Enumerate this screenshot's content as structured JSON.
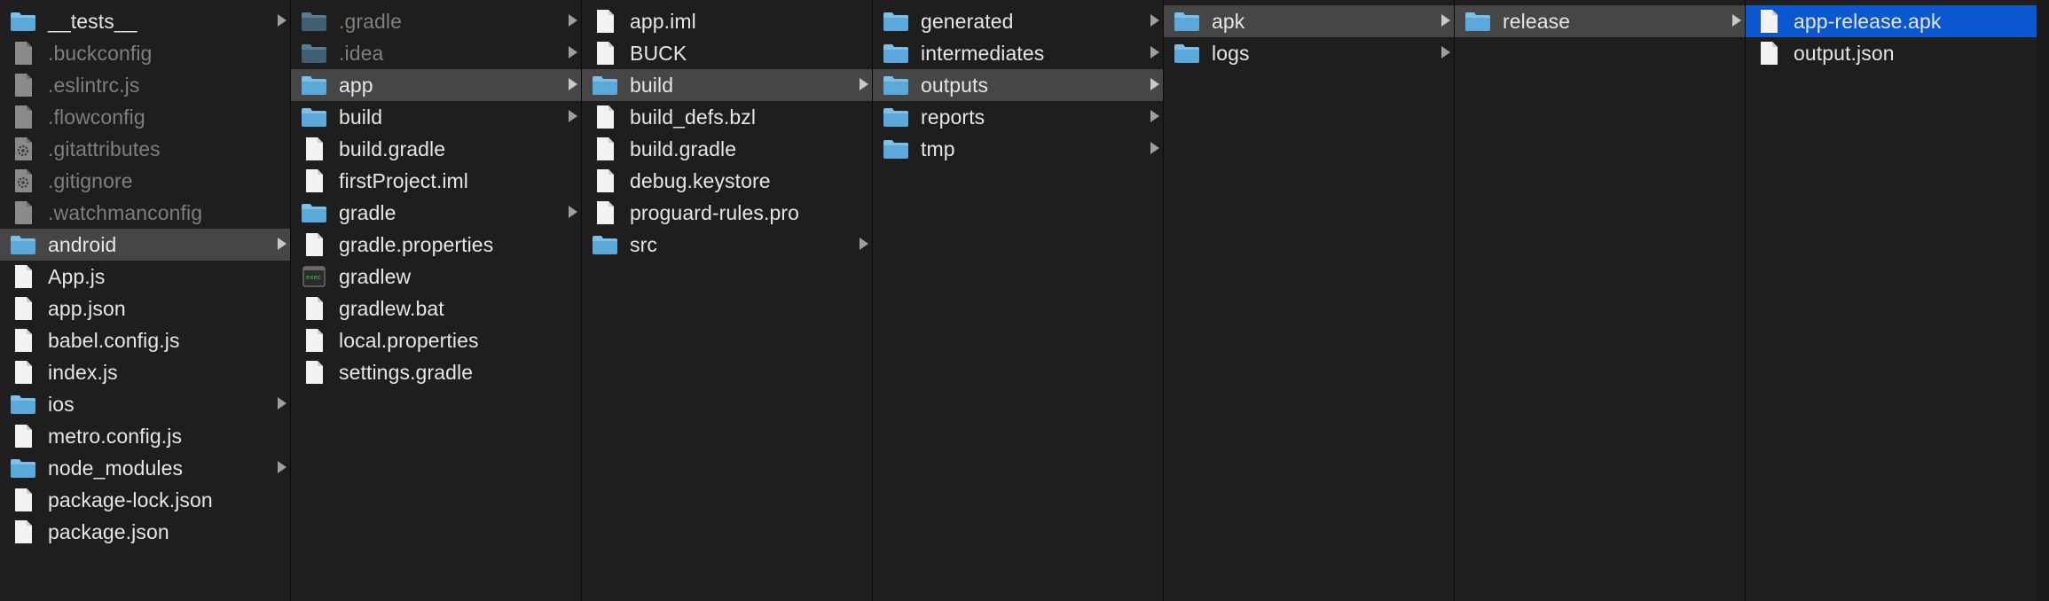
{
  "columns": [
    {
      "items": [
        {
          "name": "__tests__",
          "type": "folder",
          "arrow": true
        },
        {
          "name": ".buckconfig",
          "type": "file",
          "dim": true
        },
        {
          "name": ".eslintrc.js",
          "type": "file",
          "dim": true
        },
        {
          "name": ".flowconfig",
          "type": "file",
          "dim": true
        },
        {
          "name": ".gitattributes",
          "type": "config",
          "dim": true
        },
        {
          "name": ".gitignore",
          "type": "config",
          "dim": true
        },
        {
          "name": ".watchmanconfig",
          "type": "file",
          "dim": true
        },
        {
          "name": "android",
          "type": "folder",
          "arrow": true,
          "selected": true
        },
        {
          "name": "App.js",
          "type": "file"
        },
        {
          "name": "app.json",
          "type": "file"
        },
        {
          "name": "babel.config.js",
          "type": "file"
        },
        {
          "name": "index.js",
          "type": "file"
        },
        {
          "name": "ios",
          "type": "folder",
          "arrow": true
        },
        {
          "name": "metro.config.js",
          "type": "file"
        },
        {
          "name": "node_modules",
          "type": "folder",
          "arrow": true
        },
        {
          "name": "package-lock.json",
          "type": "file"
        },
        {
          "name": "package.json",
          "type": "file"
        }
      ]
    },
    {
      "items": [
        {
          "name": ".gradle",
          "type": "folder",
          "arrow": true,
          "dim": true
        },
        {
          "name": ".idea",
          "type": "folder",
          "arrow": true,
          "dim": true
        },
        {
          "name": "app",
          "type": "folder",
          "arrow": true,
          "selected": true
        },
        {
          "name": "build",
          "type": "folder",
          "arrow": true
        },
        {
          "name": "build.gradle",
          "type": "file"
        },
        {
          "name": "firstProject.iml",
          "type": "file"
        },
        {
          "name": "gradle",
          "type": "folder",
          "arrow": true
        },
        {
          "name": "gradle.properties",
          "type": "file"
        },
        {
          "name": "gradlew",
          "type": "exec"
        },
        {
          "name": "gradlew.bat",
          "type": "file"
        },
        {
          "name": "local.properties",
          "type": "file"
        },
        {
          "name": "settings.gradle",
          "type": "file"
        }
      ]
    },
    {
      "items": [
        {
          "name": "app.iml",
          "type": "file"
        },
        {
          "name": "BUCK",
          "type": "file"
        },
        {
          "name": "build",
          "type": "folder",
          "arrow": true,
          "selected": true
        },
        {
          "name": "build_defs.bzl",
          "type": "file"
        },
        {
          "name": "build.gradle",
          "type": "file"
        },
        {
          "name": "debug.keystore",
          "type": "file"
        },
        {
          "name": "proguard-rules.pro",
          "type": "file"
        },
        {
          "name": "src",
          "type": "folder",
          "arrow": true
        }
      ]
    },
    {
      "items": [
        {
          "name": "generated",
          "type": "folder",
          "arrow": true
        },
        {
          "name": "intermediates",
          "type": "folder",
          "arrow": true
        },
        {
          "name": "outputs",
          "type": "folder",
          "arrow": true,
          "selected": true
        },
        {
          "name": "reports",
          "type": "folder",
          "arrow": true
        },
        {
          "name": "tmp",
          "type": "folder",
          "arrow": true
        }
      ]
    },
    {
      "items": [
        {
          "name": "apk",
          "type": "folder",
          "arrow": true,
          "selected": true
        },
        {
          "name": "logs",
          "type": "folder",
          "arrow": true
        }
      ]
    },
    {
      "items": [
        {
          "name": "release",
          "type": "folder",
          "arrow": true,
          "selected": true
        }
      ]
    },
    {
      "items": [
        {
          "name": "app-release.apk",
          "type": "file",
          "active": true
        },
        {
          "name": "output.json",
          "type": "file"
        }
      ]
    }
  ],
  "colors": {
    "background": "#1e1e1e",
    "selected_row": "#464646",
    "active_row": "#0a57d0",
    "folder": "#5aa9da",
    "text": "#e6e6e6",
    "dim_text": "#7f7f7f"
  },
  "icons": {
    "folder": "folder-icon",
    "file": "document-icon",
    "config": "gear-document-icon",
    "exec": "terminal-executable-icon"
  }
}
